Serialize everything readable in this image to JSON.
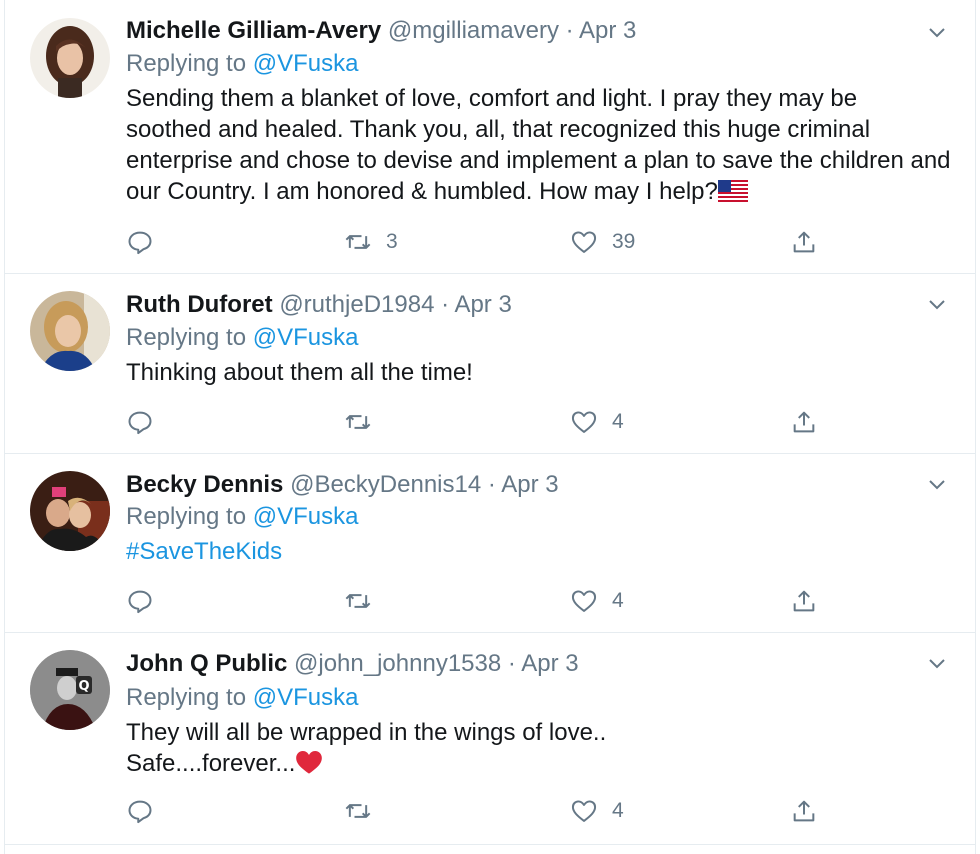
{
  "tweets": [
    {
      "name": "Michelle Gilliam-Avery",
      "handle": "@mgilliamavery",
      "separator": "·",
      "date": "Apr 3",
      "replying_prefix": "Replying to",
      "replying_to": "@VFuska",
      "text_lines": [
        "Sending them a blanket of love, comfort and light. I pray they may be",
        "soothed and healed. Thank you, all, that recognized this huge criminal",
        "enterprise and chose to devise and implement a plan to save the children and",
        "our Country. I am honored & humbled. How may I help?"
      ],
      "text_emoji": "us-flag-emoji",
      "retweets": "3",
      "likes": "39"
    },
    {
      "name": "Ruth Duforet",
      "handle": "@ruthjeD1984",
      "separator": "·",
      "date": "Apr 3",
      "replying_prefix": "Replying to",
      "replying_to": "@VFuska",
      "text_lines": [
        "Thinking about them all the time!"
      ],
      "retweets": "",
      "likes": "4"
    },
    {
      "name": "Becky Dennis",
      "handle": "@BeckyDennis14",
      "separator": "·",
      "date": "Apr 3",
      "replying_prefix": "Replying to",
      "replying_to": "@VFuska",
      "hashtag": "#SaveTheKids",
      "retweets": "",
      "likes": "4"
    },
    {
      "name": "John Q Public",
      "handle": "@john_johnny1538",
      "separator": "·",
      "date": "Apr 3",
      "replying_prefix": "Replying to",
      "replying_to": "@VFuska",
      "text_lines": [
        "They will all be wrapped in the wings of love..",
        "Safe....forever..."
      ],
      "text_emoji": "red-heart-emoji",
      "retweets": "",
      "likes": "4"
    }
  ],
  "icons": {
    "reply": "reply-icon",
    "retweet": "retweet-icon",
    "like": "heart-icon",
    "share": "share-icon",
    "menu": "chevron-down-icon"
  },
  "colors": {
    "link": "#1b95e0",
    "muted": "#657786",
    "text": "#14171a",
    "divider": "#e6ecf0"
  }
}
